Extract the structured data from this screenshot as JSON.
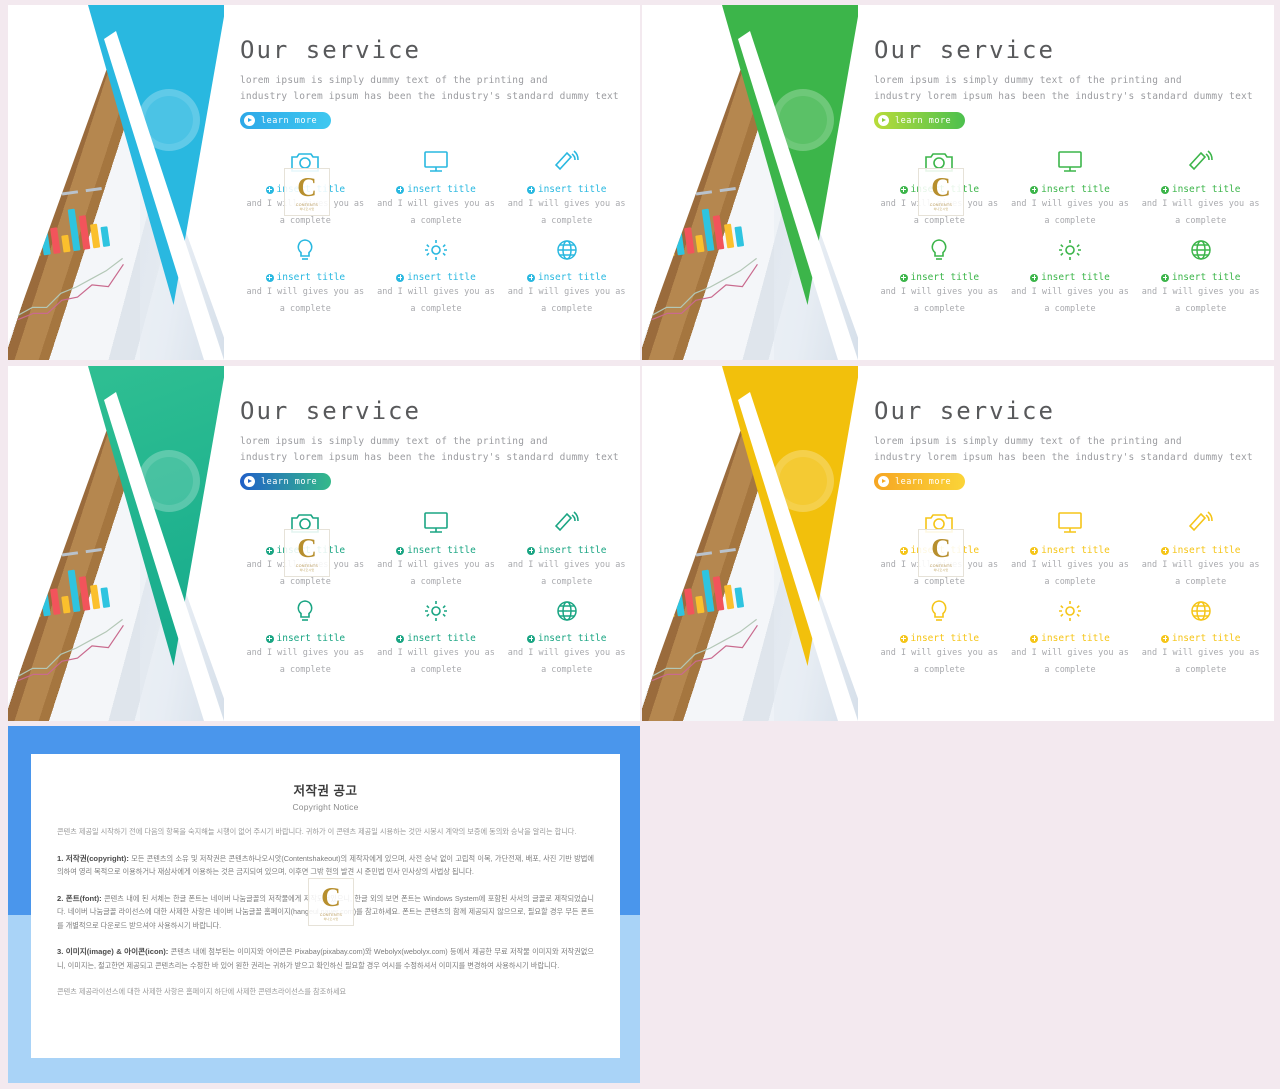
{
  "page": {
    "background_color": "#f3e9ef"
  },
  "slides": [
    {
      "id": "slide-cyan",
      "accent": "#29b8e0",
      "accent_dark": "#1f9fd0",
      "triangle_color": "#29b8e0",
      "button_gradient_from": "#2da8e8",
      "button_gradient_to": "#3fc8f0",
      "title": "Our  service",
      "lead_line1": "lorem ipsum is simply dummy text of the printing and",
      "lead_line2": "industry lorem ipsum has been the industry's standard dummy text",
      "button_label": "learn more",
      "features": [
        {
          "icon": "camera-icon",
          "title": "insert title",
          "desc": "and I will gives you as a complete"
        },
        {
          "icon": "monitor-icon",
          "title": "insert title",
          "desc": "and I will gives you as a complete"
        },
        {
          "icon": "megaphone-icon",
          "title": "insert title",
          "desc": "and I will gives you as a complete"
        },
        {
          "icon": "lightbulb-icon",
          "title": "insert title",
          "desc": "and I will gives you as a complete"
        },
        {
          "icon": "gear-icon",
          "title": "insert title",
          "desc": "and I will gives you as a complete"
        },
        {
          "icon": "globe-icon",
          "title": "insert title",
          "desc": "and I will gives you as a complete"
        }
      ]
    },
    {
      "id": "slide-green",
      "accent": "#3cb54a",
      "accent_dark": "#2fa03d",
      "triangle_color": "#3cb54a",
      "button_gradient_from": "#b9dc3a",
      "button_gradient_to": "#4cc04e",
      "title": "Our  service",
      "lead_line1": "lorem ipsum is simply dummy text of the printing and",
      "lead_line2": "industry lorem ipsum has been the industry's standard dummy text",
      "button_label": "learn more",
      "features": [
        {
          "icon": "camera-icon",
          "title": "insert title",
          "desc": "and I will gives you as a complete"
        },
        {
          "icon": "monitor-icon",
          "title": "insert title",
          "desc": "and I will gives you as a complete"
        },
        {
          "icon": "megaphone-icon",
          "title": "insert title",
          "desc": "and I will gives you as a complete"
        },
        {
          "icon": "lightbulb-icon",
          "title": "insert title",
          "desc": "and I will gives you as a complete"
        },
        {
          "icon": "gear-icon",
          "title": "insert title",
          "desc": "and I will gives you as a complete"
        },
        {
          "icon": "globe-icon",
          "title": "insert title",
          "desc": "and I will gives you as a complete"
        }
      ]
    },
    {
      "id": "slide-teal",
      "accent": "#1aa583",
      "accent_dark": "#148a6d",
      "triangle_color": "#2fbf92",
      "button_gradient_from": "#2060c8",
      "button_gradient_to": "#34b98a",
      "title": "Our  service",
      "lead_line1": "lorem ipsum is simply dummy text of the printing and",
      "lead_line2": "industry lorem ipsum has been the industry's standard dummy text",
      "button_label": "learn more",
      "features": [
        {
          "icon": "camera-icon",
          "title": "insert title",
          "desc": "and I will gives you as a complete"
        },
        {
          "icon": "monitor-icon",
          "title": "insert title",
          "desc": "and I will gives you as a complete"
        },
        {
          "icon": "megaphone-icon",
          "title": "insert title",
          "desc": "and I will gives you as a complete"
        },
        {
          "icon": "lightbulb-icon",
          "title": "insert title",
          "desc": "and I will gives you as a complete"
        },
        {
          "icon": "gear-icon",
          "title": "insert title",
          "desc": "and I will gives you as a complete"
        },
        {
          "icon": "globe-icon",
          "title": "insert title",
          "desc": "and I will gives you as a complete"
        }
      ]
    },
    {
      "id": "slide-yellow",
      "accent": "#f5c518",
      "accent_dark": "#e0ac00",
      "triangle_color": "#f2c00c",
      "button_gradient_from": "#f6a623",
      "button_gradient_to": "#fbd438",
      "title": "Our  service",
      "lead_line1": "lorem ipsum is simply dummy text of the printing and",
      "lead_line2": "industry lorem ipsum has been the industry's standard dummy text",
      "button_label": "learn more",
      "features": [
        {
          "icon": "camera-icon",
          "title": "insert title",
          "desc": "and I will gives you as a complete"
        },
        {
          "icon": "monitor-icon",
          "title": "insert title",
          "desc": "and I will gives you as a complete"
        },
        {
          "icon": "megaphone-icon",
          "title": "insert title",
          "desc": "and I will gives you as a complete"
        },
        {
          "icon": "lightbulb-icon",
          "title": "insert title",
          "desc": "and I will gives you as a complete"
        },
        {
          "icon": "gear-icon",
          "title": "insert title",
          "desc": "and I will gives you as a complete"
        },
        {
          "icon": "globe-icon",
          "title": "insert title",
          "desc": "and I will gives you as a complete"
        }
      ]
    }
  ],
  "watermark": {
    "letter": "C",
    "sub": "CONTENTS",
    "sub2": "하나오시앗"
  },
  "copyright_card": {
    "border_color_top": "#4a96ec",
    "border_color_bottom": "#a9d3f7",
    "title_ko": "저작권 공고",
    "title_en": "Copyright Notice",
    "intro": "콘텐츠 제공일 시작하기 전에 다음의 항목을 숙지해늘 시행이 없어 주시기 바랍니다. 귀하가 이 콘텐츠 제공일 시용하는 것만 시봉시 계약의 보증에 동의와 승낙을 알리는 합니다.",
    "clause1_label": "1. 저작권(copyright):",
    "clause1_text": " 모든 콘텐츠의 소유 및 저작권은 콘텐츠하나오시앗(Contentshakeout)의 제작자에게 있으며, 사전 승낙 없이 고립적 이복, 가단전재, 배포, 사진 기반 방법에 의하여 영리 목적으로 이용하거나 재삼사에게 이용하는 것은 금지되여 있으며, 이후면 그밖 현의 발견 시 준민법 민사 민사상의 사법상 됩니다.",
    "clause2_label": "2. 폰트(font):",
    "clause2_text": " 콘텐츠 내에 된 서체는 한글 폰트는 네이버 나눔글꼴의 저작물에게 저작되어있으니, 한글 외의 보면 폰트는 Windows System에 포함된 사서의 글꼴로 제작되었습니다. 네이버 나눔글꼴 라이선스에 대한 사제한 사항은 네이버 나눔글꼴 홈페이지(hangeul.naver.com)를 참고하세요. 폰트는 콘텐츠의 함께 제공되지 않으므로, 필요할 경우 무든 폰트를 개별적으로 다운로드 받으셔야 사용하시기 바랍니다.",
    "clause3_label": "3. 이미지(image) & 아이콘(icon):",
    "clause3_text": " 콘텐츠 내에 첨부된는 이미지와 아이콘은 Pixabay(pixabay.com)와 Webolyx(webolyx.com) 등에서 제공한 무료 저작물 이미지와 저작권없으니, 이미지는, 절고한면 제공되고 콘텐츠리는 수정한 바 있어 원한 권리는 귀하가 받으고 확인하신 필요할 경우 여시를 수정하셔서 이미지를 변경하여 사용하시기 바랍니다.",
    "footer": "콘텐츠 제공라이선스에 대한 사제한 사항은 홈페이지 하단에 사제한 콘텐츠라이선스를 참조하세요"
  }
}
